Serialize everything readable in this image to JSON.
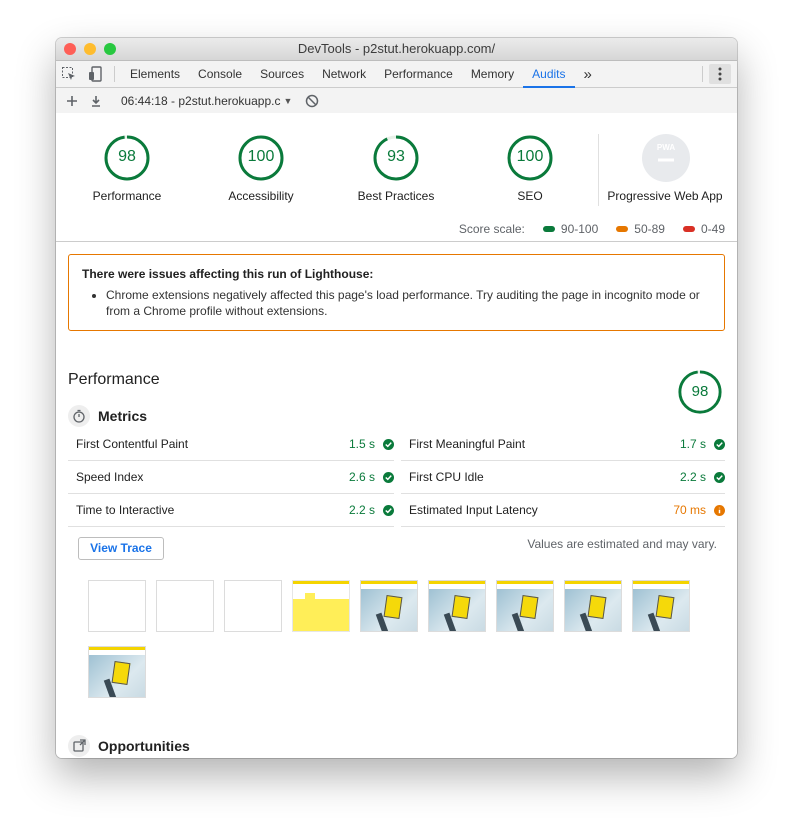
{
  "window": {
    "title": "DevTools - p2stut.herokuapp.com/"
  },
  "tabs": [
    {
      "label": "Elements"
    },
    {
      "label": "Console"
    },
    {
      "label": "Sources"
    },
    {
      "label": "Network"
    },
    {
      "label": "Performance"
    },
    {
      "label": "Memory"
    },
    {
      "label": "Audits"
    }
  ],
  "active_tab": "Audits",
  "more_tabs": "»",
  "toolbar": {
    "report_selector": "06:44:18 - p2stut.herokuapp.c"
  },
  "categories": [
    {
      "label": "Performance",
      "score": 98
    },
    {
      "label": "Accessibility",
      "score": 100
    },
    {
      "label": "Best Practices",
      "score": 93
    },
    {
      "label": "SEO",
      "score": 100
    },
    {
      "label": "Progressive Web App",
      "score": null,
      "badge": "PWA"
    }
  ],
  "score_scale": {
    "label": "Score scale:",
    "ranges": [
      {
        "label": "90-100",
        "color": "#0a7a3b"
      },
      {
        "label": "50-89",
        "color": "#e67700"
      },
      {
        "label": "0-49",
        "color": "#d93025"
      }
    ]
  },
  "warning": {
    "heading": "There were issues affecting this run of Lighthouse:",
    "items": [
      "Chrome extensions negatively affected this page's load performance. Try auditing the page in incognito mode or from a Chrome profile without extensions."
    ]
  },
  "performance": {
    "title": "Performance",
    "score": 98,
    "metrics_heading": "Metrics",
    "metrics": [
      {
        "name": "First Contentful Paint",
        "value": "1.5 s",
        "status": "pass"
      },
      {
        "name": "First Meaningful Paint",
        "value": "1.7 s",
        "status": "pass"
      },
      {
        "name": "Speed Index",
        "value": "2.6 s",
        "status": "pass"
      },
      {
        "name": "First CPU Idle",
        "value": "2.2 s",
        "status": "pass"
      },
      {
        "name": "Time to Interactive",
        "value": "2.2 s",
        "status": "pass"
      },
      {
        "name": "Estimated Input Latency",
        "value": "70 ms",
        "status": "average"
      }
    ],
    "view_trace_label": "View Trace",
    "note": "Values are estimated and may vary.",
    "filmstrip": [
      "blank",
      "blank",
      "blank",
      "yellow",
      "page",
      "page",
      "page",
      "page",
      "page",
      "page"
    ]
  },
  "opportunities": {
    "heading": "Opportunities"
  },
  "colors": {
    "pass": "#0a7a3b",
    "average": "#e67700",
    "fail": "#d93025",
    "accent": "#1a73e8"
  }
}
